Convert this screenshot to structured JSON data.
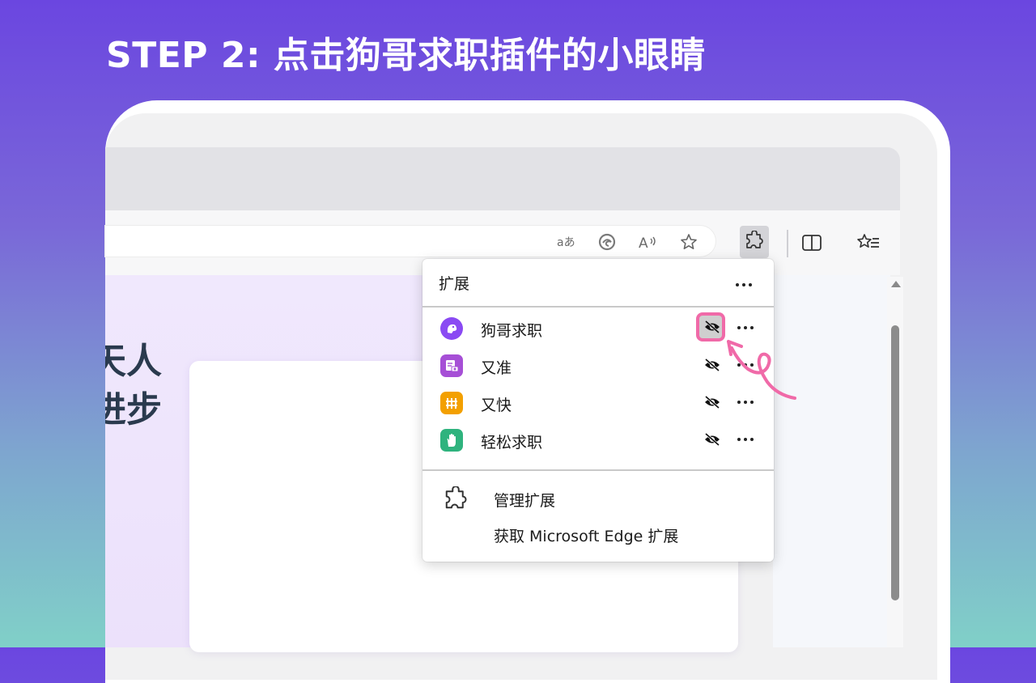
{
  "headline": "STEP 2: 点击狗哥求职插件的小眼睛",
  "toolbar": {
    "address_icons": [
      "read-aloud-translate-icon",
      "edge-logo-icon",
      "read-aloud-icon",
      "favorite-star-icon"
    ],
    "right_icons": [
      "extensions-puzzle-icon",
      "split-screen-icon",
      "favorites-list-icon"
    ]
  },
  "page": {
    "line1": "天人",
    "line2": "进步!"
  },
  "extensions_panel": {
    "title": "扩展",
    "items": [
      {
        "label": "狗哥求职",
        "icon": "dog-avatar-icon",
        "icon_color": "#8a4af3",
        "hidden_icon": "eye-slash-icon"
      },
      {
        "label": "又准",
        "icon": "resume-camera-icon",
        "icon_color": "#a64fd6",
        "hidden_icon": "eye-slash-icon"
      },
      {
        "label": "又快",
        "icon": "grid-fence-icon",
        "icon_color": "#f3a000",
        "hidden_icon": "eye-slash-icon"
      },
      {
        "label": "轻松求职",
        "icon": "hand-icon",
        "icon_color": "#2fb37e",
        "hidden_icon": "eye-slash-icon"
      }
    ],
    "manage_label": "管理扩展",
    "get_label": "获取 Microsoft Edge 扩展"
  },
  "colors": {
    "highlight": "#f06aa8",
    "accent_purple": "#6b46e0"
  }
}
